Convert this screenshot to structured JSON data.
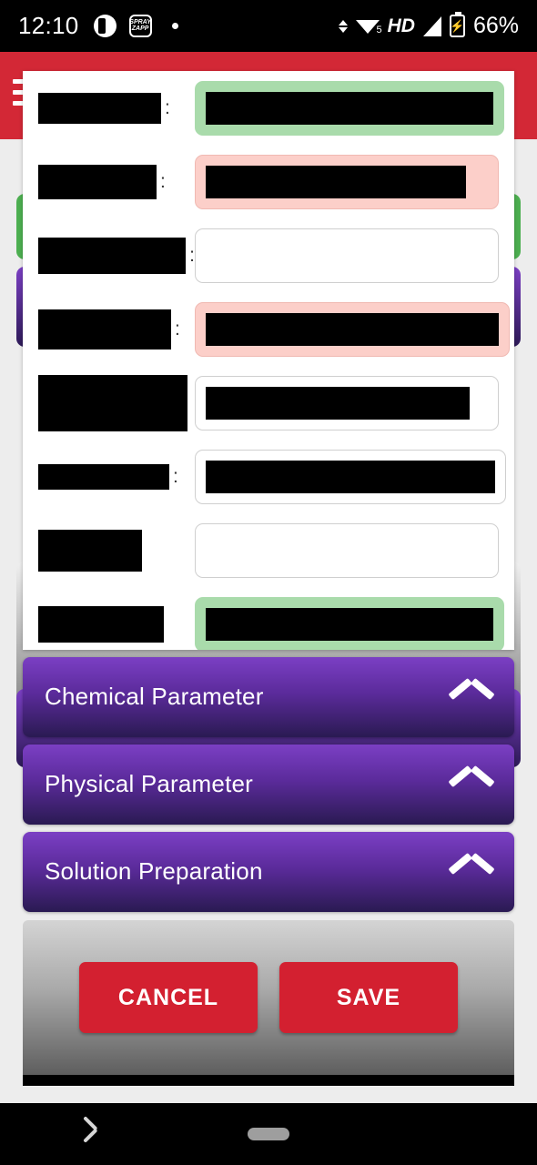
{
  "statusbar": {
    "time": "12:10",
    "icons": [
      "clock-app-icon",
      "spray-zapp-icon",
      "notification-dot-icon"
    ],
    "spray_label": "SPRAY ZAPP",
    "wifi_label": "5",
    "network_type": "HD",
    "battery_percent": "66%",
    "battery_glyph": "⚡"
  },
  "app": {
    "header_color": "#d32836",
    "menu_icon": "hamburger-menu-icon",
    "background_strips": [
      {
        "name": "green-section",
        "color": "#4caf50"
      },
      {
        "name": "purple-section-top",
        "color": "#7b3fc4"
      },
      {
        "name": "gray-section",
        "color": "#6e6e6e"
      },
      {
        "name": "purple-section-bottom",
        "color": "#7b3fc4"
      }
    ]
  },
  "dialog": {
    "form_rows": [
      {
        "label": "",
        "label_w": 135,
        "label_h": 34,
        "colon": ":",
        "value_w": 316,
        "field_state": "green",
        "field_fill": "#a9dbab"
      },
      {
        "label": "",
        "label_w": 130,
        "label_h": 38,
        "colon": ":",
        "value_w": 286,
        "field_state": "pink",
        "field_fill": "#fccfc9"
      },
      {
        "label": "",
        "label_w": 164,
        "label_h": 40,
        "colon": ":",
        "value_w": 0,
        "field_state": "plain",
        "field_fill": "#ffffff"
      },
      {
        "label": "",
        "label_w": 146,
        "label_h": 44,
        "colon": ":",
        "value_w": 322,
        "field_state": "pink",
        "field_fill": "#fccfc9"
      },
      {
        "label": "",
        "label_w": 164,
        "label_h": 62,
        "colon": "",
        "value_w": 290,
        "field_state": "plain",
        "field_fill": "#ffffff"
      },
      {
        "label": "",
        "label_w": 144,
        "label_h": 28,
        "colon": ":",
        "value_w": 318,
        "field_state": "plain",
        "field_fill": "#ffffff"
      },
      {
        "label": "",
        "label_w": 114,
        "label_h": 46,
        "colon": "",
        "value_w": 0,
        "field_state": "plain",
        "field_fill": "#ffffff"
      },
      {
        "label": "",
        "label_w": 138,
        "label_h": 40,
        "colon": "",
        "value_w": 316,
        "field_state": "green",
        "field_fill": "#a9dbab"
      }
    ],
    "sections": [
      {
        "label": "Chemical Parameter",
        "icon": "chevron-up-icon",
        "expanded": true
      },
      {
        "label": "Physical Parameter",
        "icon": "chevron-up-icon",
        "expanded": true
      },
      {
        "label": "Solution Preparation",
        "icon": "chevron-up-icon",
        "expanded": true
      }
    ],
    "buttons": {
      "cancel_label": "CANCEL",
      "save_label": "SAVE",
      "button_color": "#d32030"
    }
  },
  "navbar": {
    "back_icon": "back-chevron-icon",
    "home_icon": "home-pill-icon"
  }
}
